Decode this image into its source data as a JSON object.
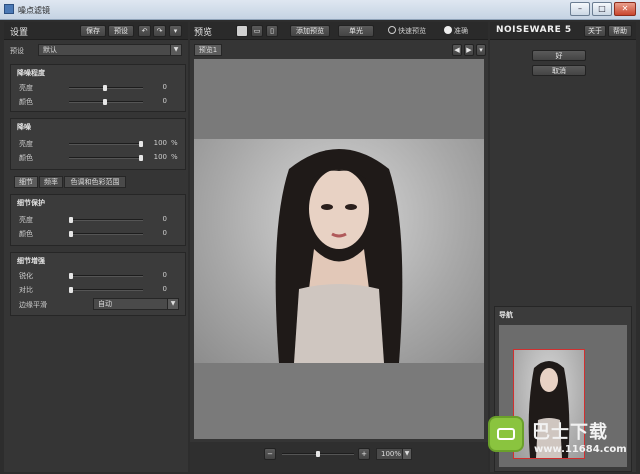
{
  "window": {
    "title": "噪点滤镜",
    "min": "–",
    "max": "□",
    "close": "✕"
  },
  "left": {
    "title": "设置",
    "save": "保存",
    "presets": "预设",
    "preset_label": "预设",
    "preset_value": "默认",
    "noise_level": {
      "title": "降噪程度",
      "rows": [
        {
          "label": "亮度",
          "value": "0"
        },
        {
          "label": "颜色",
          "value": "0"
        }
      ]
    },
    "noise_reduction": {
      "title": "降噪",
      "rows": [
        {
          "label": "亮度",
          "value": "100",
          "unit": "%"
        },
        {
          "label": "颜色",
          "value": "100",
          "unit": "%"
        }
      ]
    },
    "tabs": [
      "细节",
      "频率",
      "色调和色彩范围"
    ],
    "detail_protect": {
      "title": "细节保护",
      "rows": [
        {
          "label": "亮度",
          "value": "0"
        },
        {
          "label": "颜色",
          "value": "0"
        }
      ]
    },
    "detail_enhance": {
      "title": "细节增强",
      "rows": [
        {
          "label": "锐化",
          "value": "0"
        },
        {
          "label": "对比",
          "value": "0"
        }
      ],
      "edge_label": "边缘平滑",
      "edge_value": "自动"
    }
  },
  "center": {
    "title": "预览",
    "add_preview": "添加预览",
    "single": "单光",
    "fast_preview": "快速预览",
    "accurate": "准确",
    "tab": "预览1",
    "minus": "−",
    "plus": "+",
    "zoom": "100%"
  },
  "right": {
    "logo": "NOISEWARE 5",
    "about": "关于",
    "help": "帮助",
    "ok": "好",
    "cancel": "取消",
    "navigator": "导航"
  },
  "watermark": {
    "brand": "巴士下载",
    "url": "www.11684.com"
  }
}
